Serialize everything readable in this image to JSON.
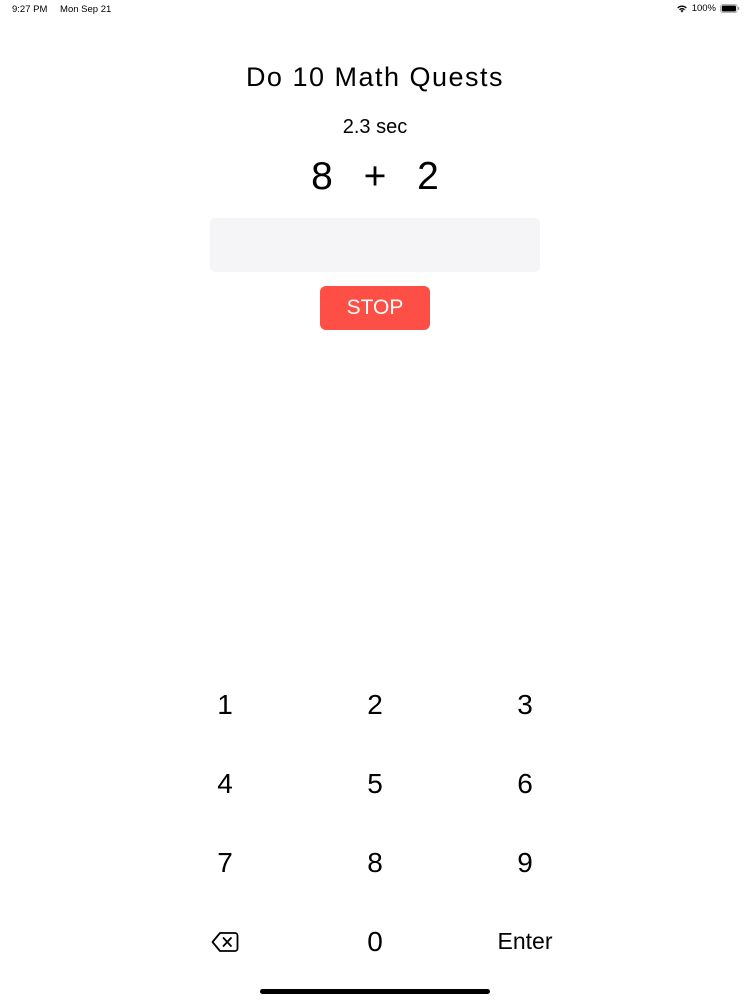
{
  "status_bar": {
    "time": "9:27 PM",
    "date": "Mon Sep 21",
    "battery_percent": "100%",
    "wifi_icon": "wifi-icon",
    "battery_icon": "battery-icon"
  },
  "title": "Do 10 Math Quests",
  "timer": "2.3 sec",
  "question": {
    "left": "8",
    "operator": "+",
    "right": "2"
  },
  "answer": {
    "value": ""
  },
  "stop_button": {
    "label": "STOP",
    "color": "#fe4f47"
  },
  "keypad": {
    "keys": [
      "1",
      "2",
      "3",
      "4",
      "5",
      "6",
      "7",
      "8",
      "9"
    ],
    "backspace_icon": "backspace-icon",
    "zero": "0",
    "enter": "Enter"
  }
}
